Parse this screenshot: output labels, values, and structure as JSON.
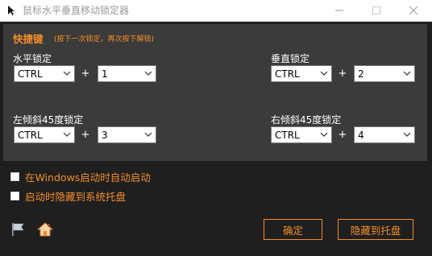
{
  "window": {
    "title": "鼠标水平垂直移动锁定器",
    "controls": [
      "minimize-icon",
      "maximize-icon",
      "close-icon"
    ]
  },
  "hotkeys": {
    "title": "快捷键",
    "hint": "(按下一次锁定，再次按下解锁)",
    "plus": "+",
    "groups": [
      {
        "label": "水平锁定",
        "modifier": "CTRL",
        "key": "1"
      },
      {
        "label": "垂直锁定",
        "modifier": "CTRL",
        "key": "2"
      },
      {
        "label": "左倾斜45度锁定",
        "modifier": "CTRL",
        "key": "3"
      },
      {
        "label": "右倾斜45度锁定",
        "modifier": "CTRL",
        "key": "4"
      }
    ]
  },
  "options": {
    "autostart": {
      "label": "在Windows启动时自动启动",
      "checked": false
    },
    "hide_tray": {
      "label": "启动时隐藏到系统托盘",
      "checked": false
    }
  },
  "footer": {
    "icons": [
      "flag-icon",
      "home-icon"
    ],
    "confirm_label": "确定",
    "hide_label": "隐藏到托盘"
  },
  "colors": {
    "accent": "#f28c28",
    "panel": "#3b3b3b",
    "background": "#1f1f1f"
  }
}
